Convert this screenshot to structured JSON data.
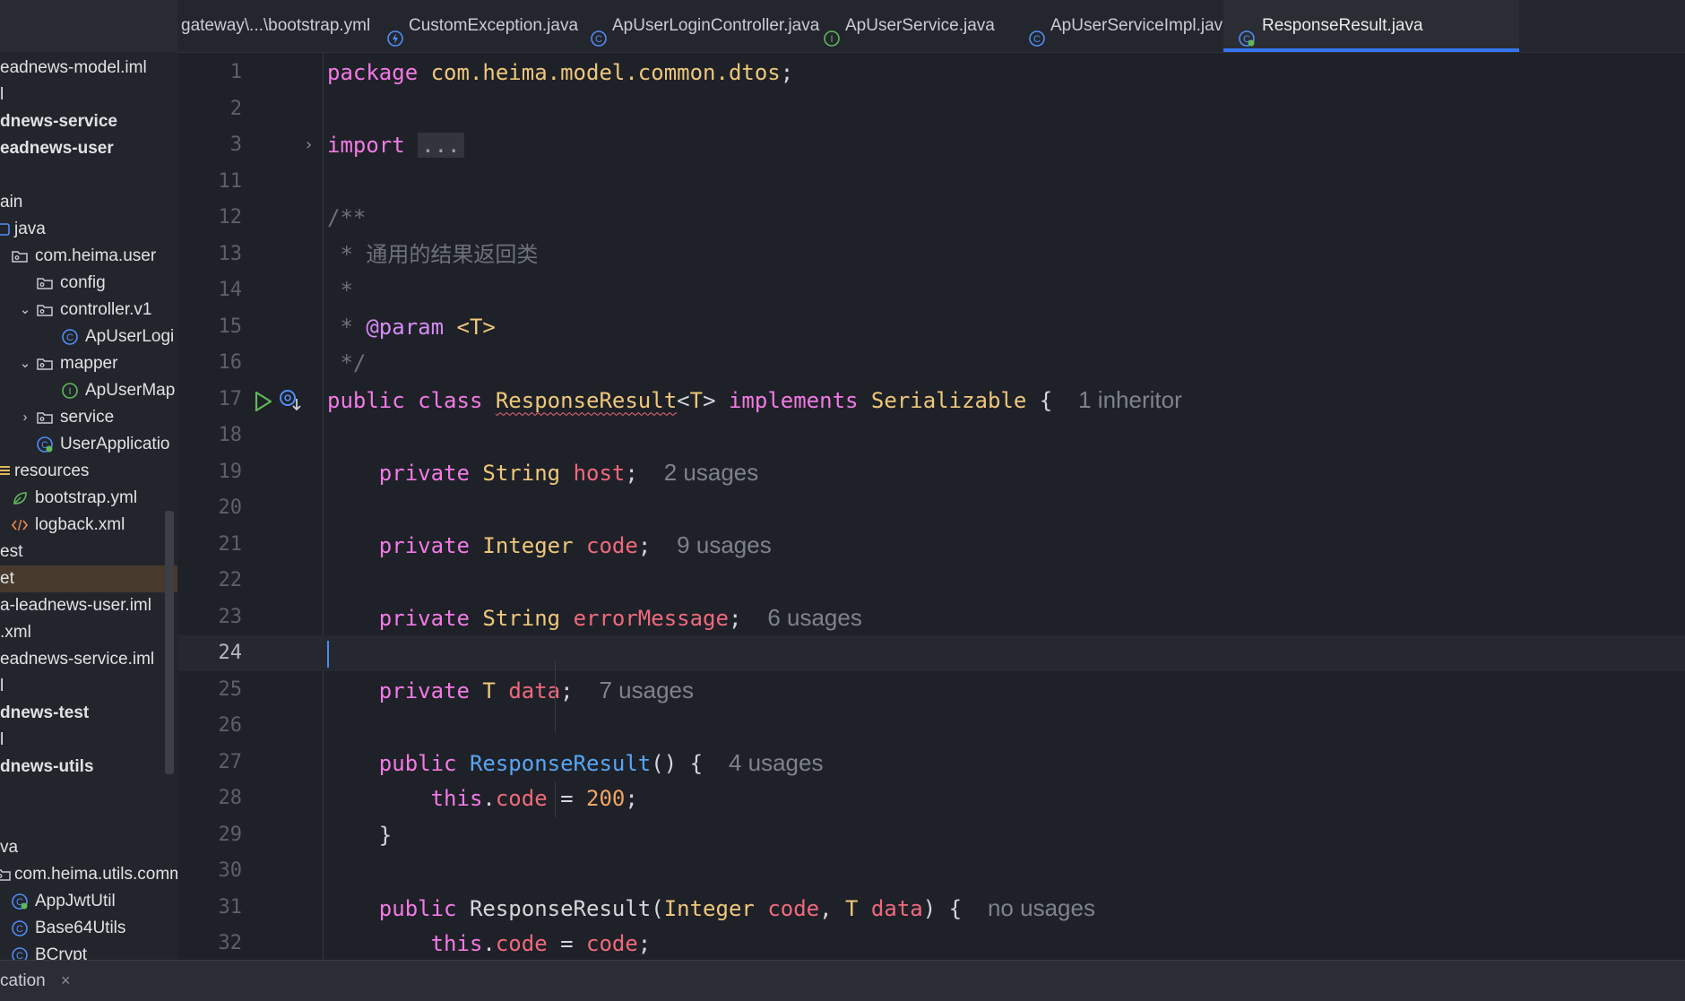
{
  "sidebar": {
    "rows": [
      {
        "label": "eadnews-model.iml",
        "icon": "",
        "arrow": "",
        "bold": false,
        "indent": 0
      },
      {
        "label": "l",
        "icon": "",
        "arrow": "",
        "bold": false,
        "indent": 0
      },
      {
        "label": "dnews-service",
        "icon": "",
        "arrow": "",
        "bold": true,
        "indent": 0
      },
      {
        "label": "eadnews-user",
        "icon": "",
        "arrow": "",
        "bold": true,
        "indent": 0
      },
      {
        "label": "",
        "icon": "",
        "arrow": "",
        "bold": false,
        "indent": 0
      },
      {
        "label": "ain",
        "icon": "",
        "arrow": "",
        "bold": false,
        "indent": 0
      },
      {
        "label": "java",
        "icon": "source-folder-icon",
        "arrow": "",
        "bold": false,
        "indent": 0
      },
      {
        "label": "com.heima.user",
        "icon": "package-icon",
        "arrow": "",
        "bold": false,
        "indent": 1
      },
      {
        "label": "config",
        "icon": "package-icon",
        "arrow": "",
        "bold": false,
        "indent": 2
      },
      {
        "label": "controller.v1",
        "icon": "package-icon",
        "arrow": "expanded",
        "bold": false,
        "indent": 2
      },
      {
        "label": "ApUserLogi",
        "icon": "class-icon",
        "arrow": "",
        "bold": false,
        "indent": 3
      },
      {
        "label": "mapper",
        "icon": "package-icon",
        "arrow": "expanded",
        "bold": false,
        "indent": 2
      },
      {
        "label": "ApUserMap",
        "icon": "interface-icon",
        "arrow": "",
        "bold": false,
        "indent": 3
      },
      {
        "label": "service",
        "icon": "package-icon",
        "arrow": "collapsed",
        "bold": false,
        "indent": 2
      },
      {
        "label": "UserApplicatio",
        "icon": "spring-class-icon",
        "arrow": "",
        "bold": false,
        "indent": 2
      },
      {
        "label": "resources",
        "icon": "resources-folder-icon",
        "arrow": "",
        "bold": false,
        "indent": 0
      },
      {
        "label": "bootstrap.yml",
        "icon": "spring-config-icon",
        "arrow": "",
        "bold": false,
        "indent": 1
      },
      {
        "label": "logback.xml",
        "icon": "xml-icon",
        "arrow": "",
        "bold": false,
        "indent": 1
      },
      {
        "label": "est",
        "icon": "",
        "arrow": "",
        "bold": false,
        "indent": 0
      },
      {
        "label": "et",
        "icon": "",
        "arrow": "",
        "bold": false,
        "indent": 0,
        "selected": true
      },
      {
        "label": "a-leadnews-user.iml",
        "icon": "",
        "arrow": "",
        "bold": false,
        "indent": 0
      },
      {
        "label": ".xml",
        "icon": "",
        "arrow": "",
        "bold": false,
        "indent": 0
      },
      {
        "label": "eadnews-service.iml",
        "icon": "",
        "arrow": "",
        "bold": false,
        "indent": 0
      },
      {
        "label": "l",
        "icon": "",
        "arrow": "",
        "bold": false,
        "indent": 0
      },
      {
        "label": "dnews-test",
        "icon": "",
        "arrow": "",
        "bold": true,
        "indent": 0
      },
      {
        "label": "l",
        "icon": "",
        "arrow": "",
        "bold": false,
        "indent": 0
      },
      {
        "label": "dnews-utils",
        "icon": "",
        "arrow": "",
        "bold": true,
        "indent": 0
      },
      {
        "label": "",
        "icon": "",
        "arrow": "",
        "bold": false,
        "indent": 0
      },
      {
        "label": "",
        "icon": "",
        "arrow": "",
        "bold": false,
        "indent": 0
      },
      {
        "label": "va",
        "icon": "",
        "arrow": "",
        "bold": false,
        "indent": 0
      },
      {
        "label": "com.heima.utils.comm",
        "icon": "package-icon",
        "arrow": "",
        "bold": false,
        "indent": 0
      },
      {
        "label": "AppJwtUtil",
        "icon": "spring-class-icon",
        "arrow": "",
        "bold": false,
        "indent": 1
      },
      {
        "label": "Base64Utils",
        "icon": "class-icon",
        "arrow": "",
        "bold": false,
        "indent": 1
      },
      {
        "label": "BCrypt",
        "icon": "class-icon",
        "arrow": "",
        "bold": false,
        "indent": 1
      }
    ]
  },
  "tabs": [
    {
      "label": "gateway\\...\\bootstrap.yml",
      "icon": "",
      "active": false
    },
    {
      "label": "CustomException.java",
      "icon": "exception-class-icon",
      "active": false
    },
    {
      "label": "ApUserLoginController.java",
      "icon": "class-icon",
      "active": false
    },
    {
      "label": "ApUserService.java",
      "icon": "interface-icon",
      "active": false
    },
    {
      "label": "ApUserServiceImpl.java",
      "icon": "class-icon",
      "active": false
    },
    {
      "label": "ResponseResult.java",
      "icon": "spring-class-icon",
      "active": true
    }
  ],
  "editor": {
    "current_line": "24",
    "lines": [
      {
        "no": "1",
        "indent": 0,
        "tokens": [
          [
            "kw",
            "package"
          ],
          [
            "pl",
            " "
          ],
          [
            "ty",
            "com.heima.model.common.dtos"
          ],
          [
            "pl",
            ";"
          ]
        ]
      },
      {
        "no": "2",
        "indent": 0,
        "tokens": []
      },
      {
        "no": "3",
        "indent": 0,
        "fold": true,
        "tokens": [
          [
            "kw",
            "import"
          ],
          [
            "pl",
            " "
          ],
          [
            "fold",
            "..."
          ]
        ]
      },
      {
        "no": "11",
        "indent": 0,
        "tokens": []
      },
      {
        "no": "12",
        "indent": 0,
        "tokens": [
          [
            "cm",
            "/**"
          ]
        ]
      },
      {
        "no": "13",
        "indent": 0,
        "tokens": [
          [
            "cm",
            " * 通用的结果返回类"
          ]
        ]
      },
      {
        "no": "14",
        "indent": 0,
        "tokens": [
          [
            "cm",
            " *"
          ]
        ]
      },
      {
        "no": "15",
        "indent": 0,
        "tokens": [
          [
            "cm",
            " * "
          ],
          [
            "ann",
            "@param"
          ],
          [
            "cm",
            " "
          ],
          [
            "ty",
            "<T>"
          ]
        ]
      },
      {
        "no": "16",
        "indent": 0,
        "tokens": [
          [
            "cm",
            " */"
          ]
        ]
      },
      {
        "no": "17",
        "indent": 0,
        "gutter": true,
        "tokens": [
          [
            "kw",
            "public"
          ],
          [
            "pl",
            " "
          ],
          [
            "kw",
            "class"
          ],
          [
            "pl",
            " "
          ],
          [
            "tysq",
            "ResponseResult"
          ],
          [
            "pl",
            "<"
          ],
          [
            "ty",
            "T"
          ],
          [
            "pl",
            "> "
          ],
          [
            "kw",
            "implements"
          ],
          [
            "pl",
            " "
          ],
          [
            "ty",
            "Serializable"
          ],
          [
            "pl",
            " {  "
          ],
          [
            "hint",
            "1 inheritor"
          ]
        ]
      },
      {
        "no": "18",
        "indent": 0,
        "tokens": []
      },
      {
        "no": "19",
        "indent": 4,
        "tokens": [
          [
            "kw",
            "private"
          ],
          [
            "pl",
            " "
          ],
          [
            "ty",
            "String"
          ],
          [
            "pl",
            " "
          ],
          [
            "fld",
            "host"
          ],
          [
            "pl",
            ";  "
          ],
          [
            "hint",
            "2 usages"
          ]
        ]
      },
      {
        "no": "20",
        "indent": 0,
        "tokens": []
      },
      {
        "no": "21",
        "indent": 4,
        "tokens": [
          [
            "kw",
            "private"
          ],
          [
            "pl",
            " "
          ],
          [
            "ty",
            "Integer"
          ],
          [
            "pl",
            " "
          ],
          [
            "fld",
            "code"
          ],
          [
            "pl",
            ";  "
          ],
          [
            "hint",
            "9 usages"
          ]
        ]
      },
      {
        "no": "22",
        "indent": 0,
        "tokens": []
      },
      {
        "no": "23",
        "indent": 4,
        "tokens": [
          [
            "kw",
            "private"
          ],
          [
            "pl",
            " "
          ],
          [
            "ty",
            "String"
          ],
          [
            "pl",
            " "
          ],
          [
            "fld",
            "errorMessage"
          ],
          [
            "pl",
            ";  "
          ],
          [
            "hint",
            "6 usages"
          ]
        ]
      },
      {
        "no": "24",
        "indent": 0,
        "tokens": []
      },
      {
        "no": "25",
        "indent": 4,
        "tokens": [
          [
            "kw",
            "private"
          ],
          [
            "pl",
            " "
          ],
          [
            "ty",
            "T"
          ],
          [
            "pl",
            " "
          ],
          [
            "fld",
            "data"
          ],
          [
            "pl",
            ";  "
          ],
          [
            "hint",
            "7 usages"
          ]
        ]
      },
      {
        "no": "26",
        "indent": 0,
        "tokens": []
      },
      {
        "no": "27",
        "indent": 4,
        "tokens": [
          [
            "kw",
            "public"
          ],
          [
            "pl",
            " "
          ],
          [
            "fn",
            "ResponseResult"
          ],
          [
            "pl",
            "() {  "
          ],
          [
            "hint",
            "4 usages"
          ]
        ]
      },
      {
        "no": "28",
        "indent": 8,
        "tokens": [
          [
            "kw",
            "this"
          ],
          [
            "pl",
            "."
          ],
          [
            "fld",
            "code"
          ],
          [
            "pl",
            " = "
          ],
          [
            "num",
            "200"
          ],
          [
            "pl",
            ";"
          ]
        ]
      },
      {
        "no": "29",
        "indent": 4,
        "tokens": [
          [
            "pl",
            "}"
          ]
        ]
      },
      {
        "no": "30",
        "indent": 0,
        "tokens": []
      },
      {
        "no": "31",
        "indent": 4,
        "tokens": [
          [
            "kw",
            "public"
          ],
          [
            "pl",
            " "
          ],
          [
            "cmname",
            "ResponseResult"
          ],
          [
            "pl",
            "("
          ],
          [
            "ty",
            "Integer"
          ],
          [
            "pl",
            " "
          ],
          [
            "fld",
            "code"
          ],
          [
            "pl",
            ", "
          ],
          [
            "ty",
            "T"
          ],
          [
            "pl",
            " "
          ],
          [
            "fld",
            "data"
          ],
          [
            "pl",
            ") {  "
          ],
          [
            "hint",
            "no usages"
          ]
        ]
      },
      {
        "no": "32",
        "indent": 8,
        "tokens": [
          [
            "kw",
            "this"
          ],
          [
            "pl",
            "."
          ],
          [
            "fld",
            "code"
          ],
          [
            "pl",
            " = "
          ],
          [
            "fld",
            "code"
          ],
          [
            "pl",
            ";"
          ]
        ]
      }
    ]
  },
  "bottom": {
    "label": "cation",
    "close": "×"
  },
  "colors": {
    "accent": "#3574f0",
    "selection": "#47392b",
    "background": "#1f2128"
  }
}
